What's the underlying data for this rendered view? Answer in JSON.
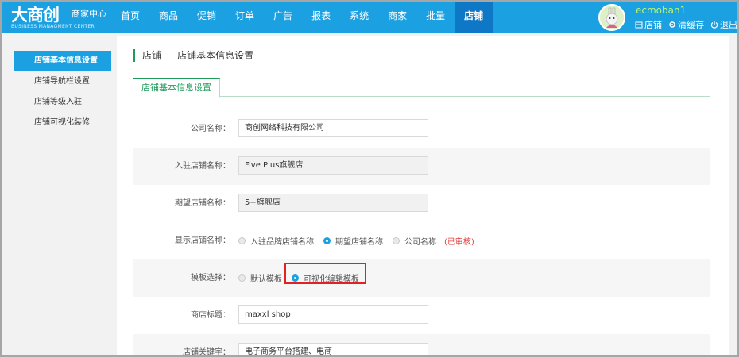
{
  "brand": {
    "logo_text": "大商创",
    "subtitle": "商家中心",
    "english": "BUSINESS MANAGMENT CENTER"
  },
  "nav": {
    "items": [
      "首页",
      "商品",
      "促销",
      "订单",
      "广告",
      "报表",
      "系统",
      "商家",
      "批量",
      "店铺"
    ],
    "active": "店铺"
  },
  "user": {
    "name": "ecmoban1",
    "links": [
      {
        "label": "店铺",
        "icon": "store-icon"
      },
      {
        "label": "清缓存",
        "icon": "gear-icon"
      },
      {
        "label": "退出",
        "icon": "power-icon"
      }
    ]
  },
  "sidebar": {
    "items": [
      {
        "label": "店铺基本信息设置",
        "active": true
      },
      {
        "label": "店铺导航栏设置",
        "active": false
      },
      {
        "label": "店铺等级入驻",
        "active": false
      },
      {
        "label": "店铺可视化装修",
        "active": false
      }
    ]
  },
  "page": {
    "title": "店铺 - - 店铺基本信息设置",
    "tab": "店铺基本信息设置"
  },
  "form": {
    "company_label": "公司名称：",
    "company_value": "商创网络科技有限公司",
    "joined_label": "入驻店铺名称：",
    "joined_value": "Five Plus旗舰店",
    "expected_label": "期望店铺名称：",
    "expected_value": "5+旗舰店",
    "display_label": "显示店铺名称：",
    "display_options": [
      "入驻品牌店铺名称",
      "期望店铺名称",
      "公司名称"
    ],
    "display_selected": "期望店铺名称",
    "display_status": "(已审核)",
    "template_label": "模板选择：",
    "template_options": [
      "默认模板",
      "可视化编辑模板"
    ],
    "template_selected": "可视化编辑模板",
    "title_label": "商店标题：",
    "title_value": "maxxl shop",
    "keywords_label": "店铺关键字：",
    "keywords_value": "电子商务平台搭建、电商"
  },
  "colors": {
    "accent": "#1ba1e2",
    "nav_active": "#0e78c6",
    "green": "#1f9b5a",
    "red": "#e22222"
  }
}
